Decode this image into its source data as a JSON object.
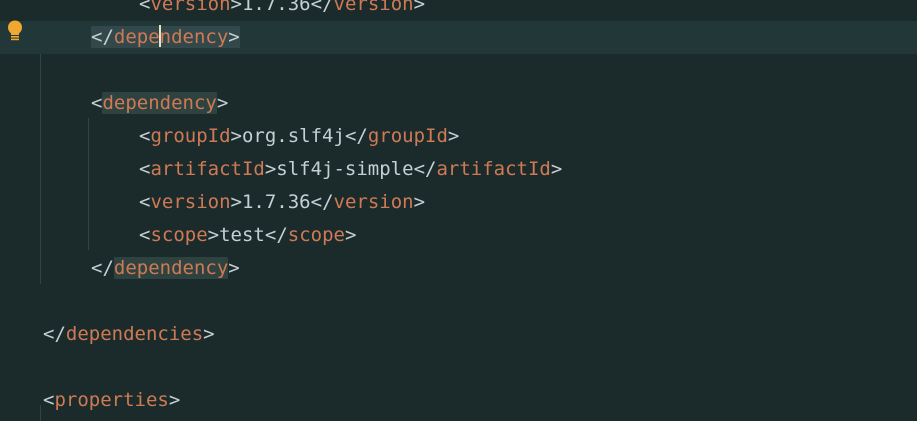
{
  "editor": {
    "lines": [
      {
        "indent": 2,
        "parts": [
          {
            "t": "br",
            "v": "<"
          },
          {
            "t": "tag",
            "v": "version"
          },
          {
            "t": "br",
            "v": ">"
          },
          {
            "t": "txt",
            "v": "1.7.36"
          },
          {
            "t": "br",
            "v": "</"
          },
          {
            "t": "tag",
            "v": "version"
          },
          {
            "t": "br",
            "v": ">"
          }
        ]
      },
      {
        "indent": 1,
        "current": true,
        "parts": [
          {
            "t": "br",
            "v": "</"
          },
          {
            "t": "tag",
            "v": "depe"
          },
          {
            "t": "caret",
            "v": ""
          },
          {
            "t": "tag",
            "v": "ndency"
          },
          {
            "t": "br",
            "v": ">"
          }
        ]
      },
      {
        "indent": 0,
        "parts": []
      },
      {
        "indent": 1,
        "parts": [
          {
            "t": "br",
            "v": "<"
          },
          {
            "t": "tag",
            "v": "dependency"
          },
          {
            "t": "br",
            "v": ">"
          }
        ]
      },
      {
        "indent": 2,
        "parts": [
          {
            "t": "br",
            "v": "<"
          },
          {
            "t": "tag",
            "v": "groupId"
          },
          {
            "t": "br",
            "v": ">"
          },
          {
            "t": "txt",
            "v": "org.slf4j"
          },
          {
            "t": "br",
            "v": "</"
          },
          {
            "t": "tag",
            "v": "groupId"
          },
          {
            "t": "br",
            "v": ">"
          }
        ]
      },
      {
        "indent": 2,
        "parts": [
          {
            "t": "br",
            "v": "<"
          },
          {
            "t": "tag",
            "v": "artifactId"
          },
          {
            "t": "br",
            "v": ">"
          },
          {
            "t": "txt",
            "v": "slf4j-simple"
          },
          {
            "t": "br",
            "v": "</"
          },
          {
            "t": "tag",
            "v": "artifactId"
          },
          {
            "t": "br",
            "v": ">"
          }
        ]
      },
      {
        "indent": 2,
        "parts": [
          {
            "t": "br",
            "v": "<"
          },
          {
            "t": "tag",
            "v": "version"
          },
          {
            "t": "br",
            "v": ">"
          },
          {
            "t": "txt",
            "v": "1.7.36"
          },
          {
            "t": "br",
            "v": "</"
          },
          {
            "t": "tag",
            "v": "version"
          },
          {
            "t": "br",
            "v": ">"
          }
        ]
      },
      {
        "indent": 2,
        "parts": [
          {
            "t": "br",
            "v": "<"
          },
          {
            "t": "tag",
            "v": "scope"
          },
          {
            "t": "br",
            "v": ">"
          },
          {
            "t": "txt",
            "v": "test"
          },
          {
            "t": "br",
            "v": "</"
          },
          {
            "t": "tag",
            "v": "scope"
          },
          {
            "t": "br",
            "v": ">"
          }
        ]
      },
      {
        "indent": 1,
        "parts": [
          {
            "t": "br",
            "v": "</"
          },
          {
            "t": "tag",
            "v": "dependency"
          },
          {
            "t": "br",
            "v": ">"
          }
        ]
      },
      {
        "indent": 0,
        "parts": []
      },
      {
        "indent": 0,
        "parts": [
          {
            "t": "br",
            "v": "</"
          },
          {
            "t": "tag",
            "v": "dependencies"
          },
          {
            "t": "br",
            "v": ">"
          }
        ]
      },
      {
        "indent": 0,
        "parts": []
      },
      {
        "indent": 0,
        "parts": [
          {
            "t": "br",
            "v": "<"
          },
          {
            "t": "tag",
            "v": "properties"
          },
          {
            "t": "br",
            "v": ">"
          }
        ]
      }
    ],
    "gutter_icon": "lightbulb-icon",
    "colors": {
      "background": "#1b2b2b",
      "current_line": "#223838",
      "tag": "#cf7a55",
      "text": "#c6d0d4",
      "match_highlight": "#2e4340",
      "bulb": "#f0a830"
    }
  }
}
